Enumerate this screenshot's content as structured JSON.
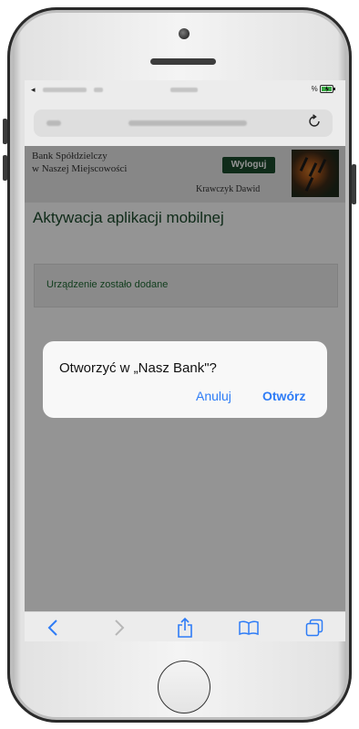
{
  "colors": {
    "bank_green": "#1b4a2c",
    "message_green": "#1f6b34",
    "ios_blue": "#2e7cf6"
  },
  "status_bar": {
    "battery_percent": "%"
  },
  "browser": {
    "reload_icon": "reload-icon",
    "toolbar": {
      "back_icon": "chevron-left-icon",
      "forward_icon": "chevron-right-icon",
      "share_icon": "share-icon",
      "bookmarks_icon": "book-icon",
      "tabs_icon": "tabs-icon"
    }
  },
  "page": {
    "bank_name_line1": "Bank Spółdzielczy",
    "bank_name_line2": "w Naszej Miejscowości",
    "logout_label": "Wyloguj",
    "user_name": "Krawczyk Dawid",
    "title": "Aktywacja aplikacji mobilnej",
    "message": "Urządzenie zostało dodane"
  },
  "dialog": {
    "title": "Otworzyć w „Nasz Bank\"?",
    "cancel_label": "Anuluj",
    "open_label": "Otwórz"
  }
}
